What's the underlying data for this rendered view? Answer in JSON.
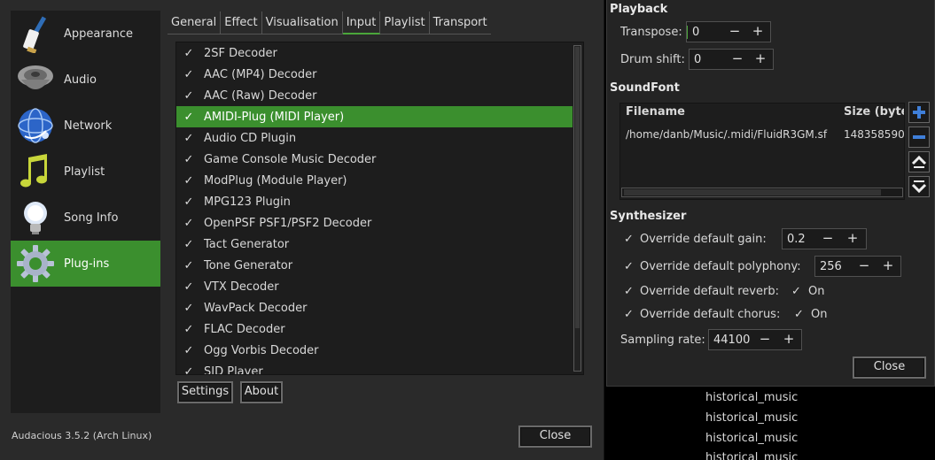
{
  "left_window": {
    "categories": [
      {
        "label": "Appearance",
        "icon": "paintbrush-icon",
        "selected": false
      },
      {
        "label": "Audio",
        "icon": "speaker-icon",
        "selected": false
      },
      {
        "label": "Network",
        "icon": "globe-icon",
        "selected": false
      },
      {
        "label": "Playlist",
        "icon": "music-note-icon",
        "selected": false
      },
      {
        "label": "Song Info",
        "icon": "lightbulb-icon",
        "selected": false
      },
      {
        "label": "Plug-ins",
        "icon": "gear-icon",
        "selected": true
      }
    ],
    "tabs": [
      "General",
      "Effect",
      "Visualisation",
      "Input",
      "Playlist",
      "Transport"
    ],
    "active_tab": "Input",
    "plugins": [
      {
        "name": "2SF Decoder",
        "checked": true
      },
      {
        "name": "AAC (MP4) Decoder",
        "checked": true
      },
      {
        "name": "AAC (Raw) Decoder",
        "checked": true
      },
      {
        "name": "AMIDI-Plug (MIDI Player)",
        "checked": true,
        "selected": true
      },
      {
        "name": "Audio CD Plugin",
        "checked": true
      },
      {
        "name": "Game Console Music Decoder",
        "checked": true
      },
      {
        "name": "ModPlug (Module Player)",
        "checked": true
      },
      {
        "name": "MPG123 Plugin",
        "checked": true
      },
      {
        "name": "OpenPSF PSF1/PSF2 Decoder",
        "checked": true
      },
      {
        "name": "Tact Generator",
        "checked": true
      },
      {
        "name": "Tone Generator",
        "checked": true
      },
      {
        "name": "VTX Decoder",
        "checked": true
      },
      {
        "name": "WavPack Decoder",
        "checked": true
      },
      {
        "name": "FLAC Decoder",
        "checked": true
      },
      {
        "name": "Ogg Vorbis Decoder",
        "checked": true
      },
      {
        "name": "SID Player",
        "checked": true
      }
    ],
    "check_glyph": "✓",
    "settings_label": "Settings",
    "about_label": "About",
    "version": "Audacious 3.5.2 (Arch Linux)",
    "close_label": "Close",
    "accent": "#3b8f2e"
  },
  "right_window": {
    "playback_heading": "Playback",
    "transpose_label": "Transpose:",
    "transpose_value": "0",
    "drum_shift_label": "Drum shift:",
    "drum_shift_value": "0",
    "minus": "−",
    "plus": "+",
    "soundfont_heading": "SoundFont",
    "col_filename": "Filename",
    "col_size": "Size (byte",
    "sf_filename": "/home/danb/Music/.midi/FluidR3GM.sf",
    "sf_size": "148358590",
    "synth_heading": "Synthesizer",
    "gain_label": "Override default gain:",
    "gain_value": "0.2",
    "poly_label": "Override default polyphony:",
    "poly_value": "256",
    "reverb_label": "Override default reverb:",
    "reverb_value": "On",
    "chorus_label": "Override default chorus:",
    "chorus_value": "On",
    "rate_label": "Sampling rate:",
    "rate_value": "44100",
    "close_label": "Close"
  },
  "background_items": [
    "historical_music",
    "historical_music",
    "historical_music",
    "historical_music"
  ]
}
